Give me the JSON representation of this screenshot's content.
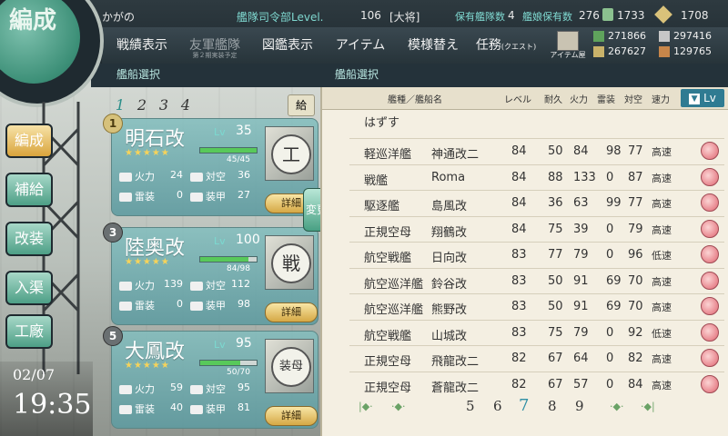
{
  "header": {
    "admiral_name": "かがの",
    "hq_level_label": "艦隊司令部Level.",
    "hq_level": "106",
    "rank": "[大将]",
    "ships_label": "保有艦隊数",
    "ships_count": "4",
    "girls_label": "艦娘保有数",
    "girls_count": "276",
    "bucket_count": "1733",
    "devmat_count": "1708"
  },
  "nav": {
    "items": [
      {
        "label": "戦績表示"
      },
      {
        "label": "友軍艦隊",
        "sub": "第２期実装予定"
      },
      {
        "label": "図鑑表示"
      },
      {
        "label": "アイテム"
      },
      {
        "label": "模様替え"
      },
      {
        "label": "任務",
        "sub2": "(クエスト)"
      }
    ],
    "item_shop_label": "アイテム屋"
  },
  "resources": {
    "fuel": "271866",
    "steel": "297416",
    "ammo": "267627",
    "bauxite": "129765"
  },
  "section": {
    "left_title": "艦船選択",
    "right_title": "艦船選択"
  },
  "sidebar": {
    "main_label": "編成",
    "items": [
      {
        "label": "編成"
      },
      {
        "label": "補給"
      },
      {
        "label": "改装"
      },
      {
        "label": "入渠"
      },
      {
        "label": "工廠"
      }
    ],
    "change_label": "変更"
  },
  "clock": {
    "date": "02/07",
    "time": "19:35"
  },
  "fleet": {
    "tabs": [
      "1",
      "2",
      "3",
      "4"
    ],
    "supply_badge": "給",
    "ships": [
      {
        "num": "1",
        "name": "明石改",
        "lv_label": "Lv",
        "lv": "35",
        "stars": "★★★★★",
        "hp": "45/45",
        "hp_frac": 1.0,
        "firepower_label": "火力",
        "firepower": "24",
        "aa_label": "対空",
        "aa": "36",
        "torpedo_label": "雷装",
        "torpedo": "0",
        "armor_label": "装甲",
        "armor": "27",
        "type_icon": "工",
        "detail_label": "詳細"
      },
      {
        "num": "3",
        "name": "陸奥改",
        "lv_label": "Lv",
        "lv": "100",
        "stars": "★★★★★",
        "hp": "84/98",
        "hp_frac": 0.857,
        "firepower_label": "火力",
        "firepower": "139",
        "aa_label": "対空",
        "aa": "112",
        "torpedo_label": "雷装",
        "torpedo": "0",
        "armor_label": "装甲",
        "armor": "98",
        "type_icon": "戦",
        "detail_label": "詳細"
      },
      {
        "num": "5",
        "name": "大鳳改",
        "lv_label": "Lv",
        "lv": "95",
        "stars": "★★★★★",
        "hp": "50/70",
        "hp_frac": 0.714,
        "firepower_label": "火力",
        "firepower": "59",
        "aa_label": "対空",
        "aa": "95",
        "torpedo_label": "雷装",
        "torpedo": "40",
        "armor_label": "装甲",
        "armor": "81",
        "type_icon": "装母",
        "detail_label": "詳細"
      }
    ]
  },
  "list": {
    "headers": {
      "name": "艦種／艦船名",
      "level": "レベル",
      "hp": "耐久",
      "fire": "火力",
      "torp": "雷装",
      "aa": "対空",
      "speed": "速力"
    },
    "sort_label": "Lv",
    "unequip_label": "はずす",
    "rows": [
      {
        "type": "軽巡洋艦",
        "name": "神通改二",
        "lv": "84",
        "hp": "50",
        "fp": "84",
        "tp": "98",
        "aa": "77",
        "spd": "高速"
      },
      {
        "type": "戦艦",
        "name": "Roma",
        "lv": "84",
        "hp": "88",
        "fp": "133",
        "tp": "0",
        "aa": "87",
        "spd": "高速"
      },
      {
        "type": "駆逐艦",
        "name": "島風改",
        "lv": "84",
        "hp": "36",
        "fp": "63",
        "tp": "99",
        "aa": "77",
        "spd": "高速"
      },
      {
        "type": "正規空母",
        "name": "翔鶴改",
        "lv": "84",
        "hp": "75",
        "fp": "39",
        "tp": "0",
        "aa": "79",
        "spd": "高速"
      },
      {
        "type": "航空戦艦",
        "name": "日向改",
        "lv": "83",
        "hp": "77",
        "fp": "79",
        "tp": "0",
        "aa": "96",
        "spd": "低速"
      },
      {
        "type": "航空巡洋艦",
        "name": "鈴谷改",
        "lv": "83",
        "hp": "50",
        "fp": "91",
        "tp": "69",
        "aa": "70",
        "spd": "高速"
      },
      {
        "type": "航空巡洋艦",
        "name": "熊野改",
        "lv": "83",
        "hp": "50",
        "fp": "91",
        "tp": "69",
        "aa": "70",
        "spd": "高速"
      },
      {
        "type": "航空戦艦",
        "name": "山城改",
        "lv": "83",
        "hp": "75",
        "fp": "79",
        "tp": "0",
        "aa": "92",
        "spd": "低速"
      },
      {
        "type": "正規空母",
        "name": "飛龍改二",
        "lv": "82",
        "hp": "67",
        "fp": "64",
        "tp": "0",
        "aa": "82",
        "spd": "高速"
      },
      {
        "type": "正規空母",
        "name": "蒼龍改二",
        "lv": "82",
        "hp": "67",
        "fp": "57",
        "tp": "0",
        "aa": "84",
        "spd": "高速"
      }
    ],
    "pages": [
      "5",
      "6",
      "7",
      "8",
      "9"
    ],
    "current_page": "7"
  }
}
